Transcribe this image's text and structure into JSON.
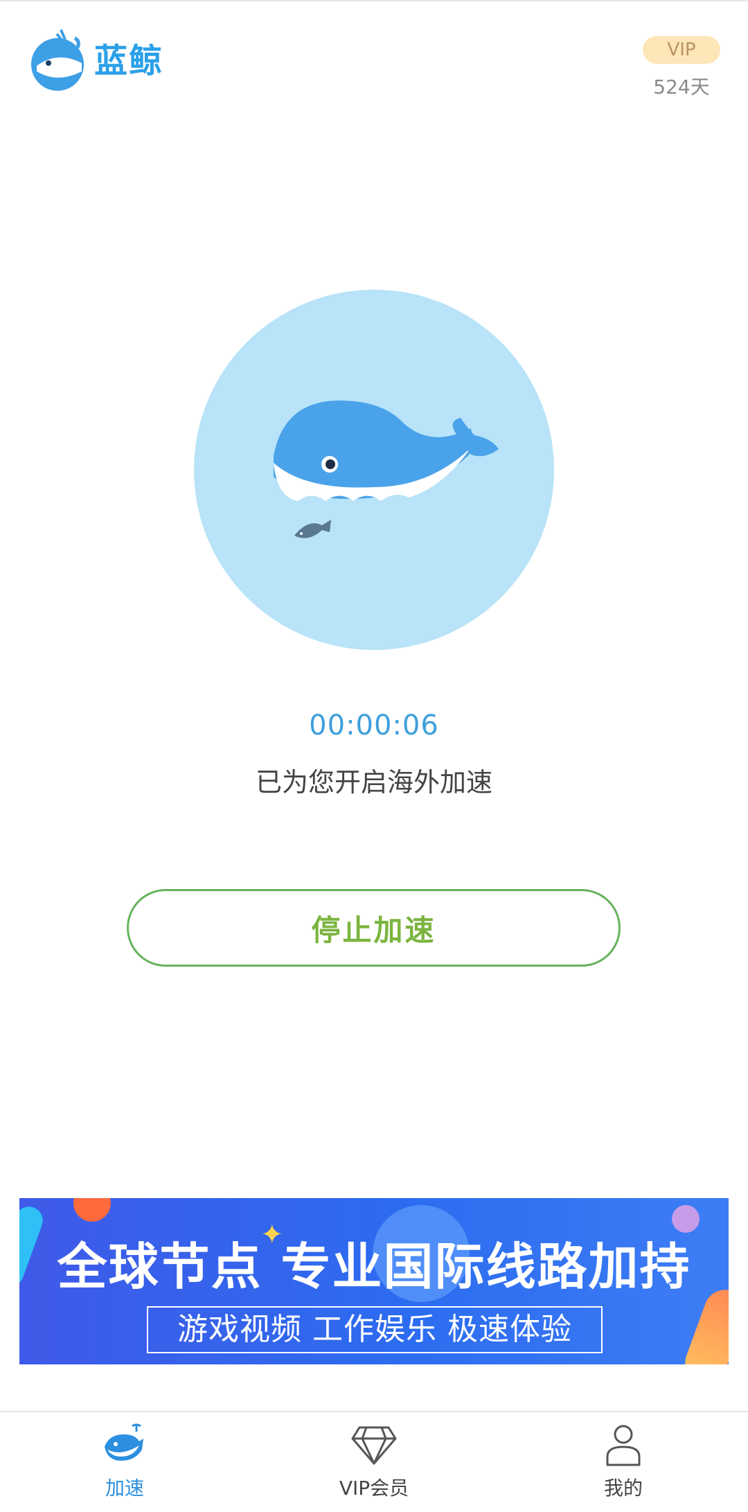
{
  "header": {
    "app_name": "蓝鲸",
    "vip_badge": "VIP",
    "vip_days": "524天",
    "logo_icon": "whale-logo-icon"
  },
  "main": {
    "hero_icon": "whale-icon",
    "timer": "00:00:06",
    "status": "已为您开启海外加速",
    "stop_button": "停止加速"
  },
  "banner": {
    "title": "全球节点 专业国际线路加持",
    "subtitle": "游戏视频 工作娱乐 极速体验"
  },
  "bottom_nav": {
    "items": [
      {
        "label": "加速",
        "icon": "whale-accelerate-icon",
        "active": true
      },
      {
        "label": "VIP会员",
        "icon": "diamond-icon",
        "active": false
      },
      {
        "label": "我的",
        "icon": "user-icon",
        "active": false
      }
    ]
  },
  "colors": {
    "accent": "#2c8fdf",
    "circle_bg": "#b8e3f8",
    "whale": "#4aa2ea",
    "stop_border": "#66b35d",
    "stop_text": "#7bb43f",
    "vip_bg": "#fde6b8"
  }
}
